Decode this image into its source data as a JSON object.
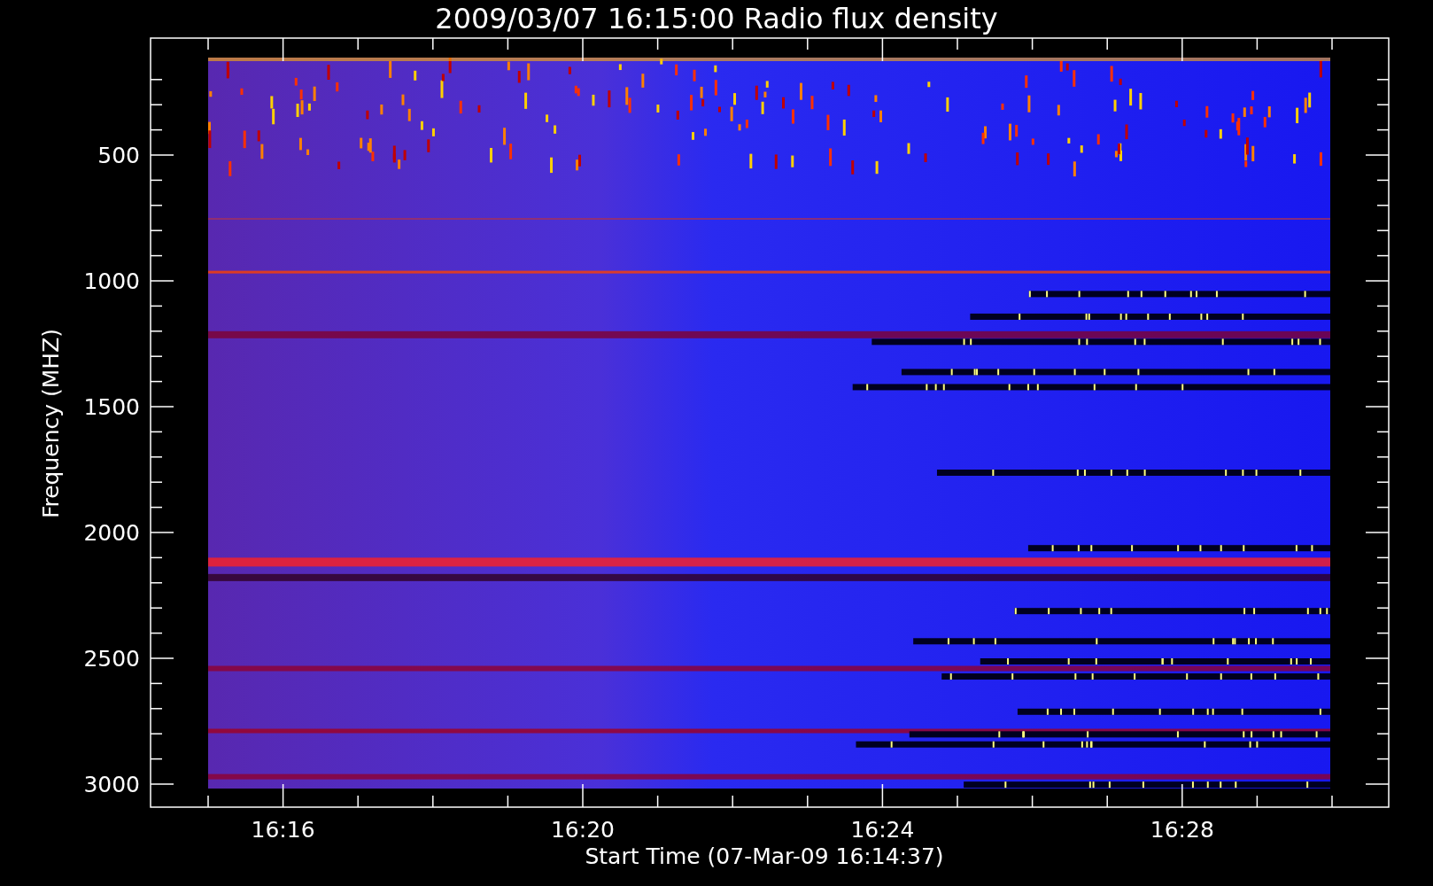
{
  "title": "2009/03/07 16:15:00 Radio flux density",
  "plot": {
    "xlabel": "Start Time (07-Mar-09 16:14:37)",
    "ylabel": "Frequency (MHZ)",
    "xticks": [
      "16:16",
      "16:20",
      "16:24",
      "16:28"
    ],
    "yticks": [
      "500",
      "1000",
      "1500",
      "2000",
      "2500",
      "3000"
    ]
  }
}
